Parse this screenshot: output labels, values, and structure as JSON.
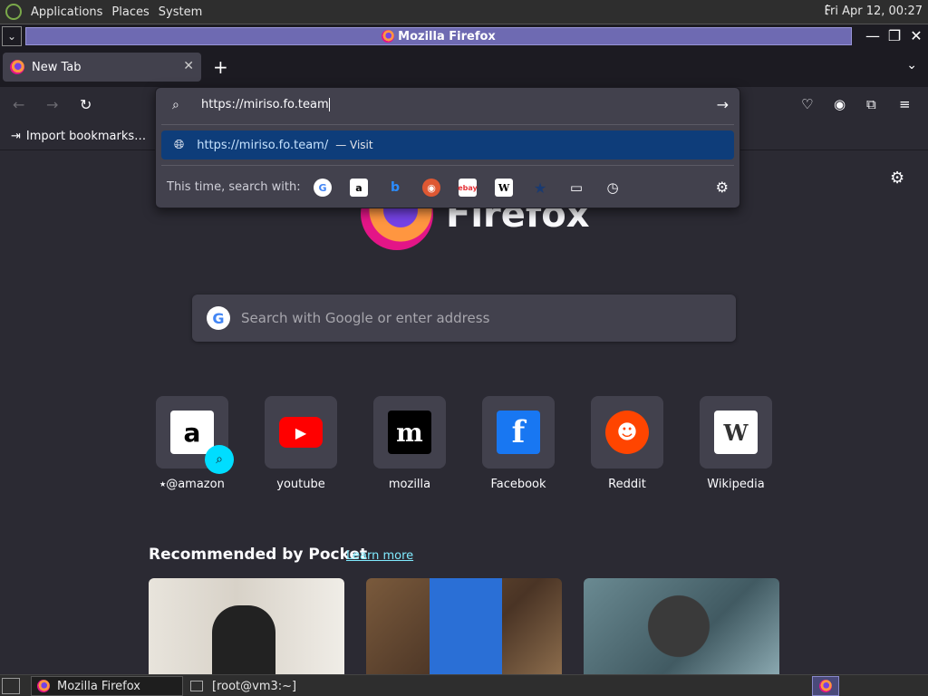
{
  "top_panel": {
    "applications": "Applications",
    "places": "Places",
    "system": "System",
    "clock": "Fri Apr 12, 00:27"
  },
  "window": {
    "title": "Mozilla Firefox"
  },
  "tab": {
    "label": "New Tab",
    "close": "✕"
  },
  "newtab_plus": "+",
  "tab_list": "⌄",
  "nav": {
    "back": "←",
    "forward": "→",
    "reload": "↻"
  },
  "toolbar_icons": [
    "pocket-icon",
    "account-icon",
    "extensions-icon",
    "menu-icon"
  ],
  "bookmarks": {
    "import": "Import bookmarks…"
  },
  "urlbar": {
    "value": "https://miriso.fo.team",
    "result_url": "https://miriso.fo.team/",
    "result_action": "— Visit",
    "oneoff_label": "This time, search with:",
    "engines": [
      "Google",
      "Amazon",
      "Bing",
      "DuckDuckGo",
      "eBay",
      "Wikipedia",
      "Bookmarks",
      "Tabs",
      "History"
    ]
  },
  "newtab": {
    "wordmark": "Firefox",
    "search_placeholder": "Search with Google or enter address",
    "shortcuts": [
      {
        "label": "@amazon",
        "icon": "amazon-icon"
      },
      {
        "label": "youtube",
        "icon": "youtube-icon"
      },
      {
        "label": "mozilla",
        "icon": "mozilla-icon"
      },
      {
        "label": "Facebook",
        "icon": "facebook-icon"
      },
      {
        "label": "Reddit",
        "icon": "reddit-icon"
      },
      {
        "label": "Wikipedia",
        "icon": "wikipedia-icon"
      }
    ],
    "pocket_title": "Recommended by Pocket",
    "pocket_learn": "Learn more"
  },
  "taskbar": {
    "task1": "Mozilla Firefox",
    "task2": "[root@vm3:~]"
  },
  "colors": {
    "accent": "#00ddff",
    "selected_row": "#0e3d7a",
    "title_bar": "#6e6ab2"
  }
}
